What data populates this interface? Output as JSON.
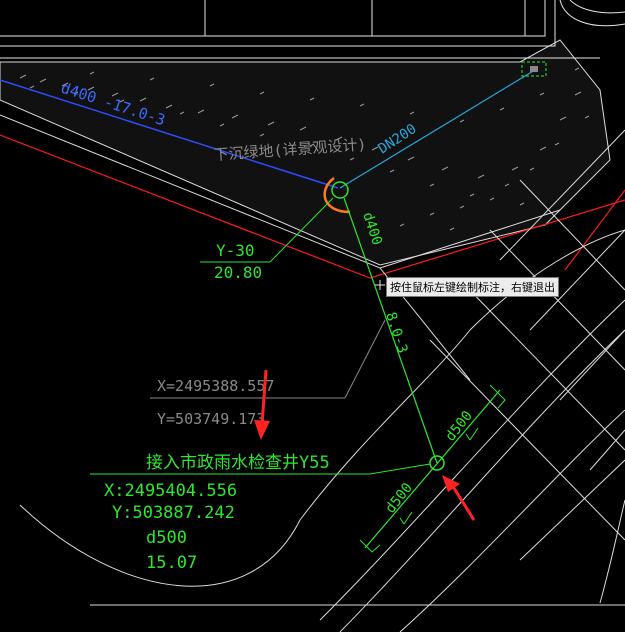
{
  "drawing": {
    "pipe_upstream_label": "d400 -17.0-3",
    "pipe_dn_label": "DN200",
    "area_label": "下沉绿地(详景观设计)",
    "manhole_id": "Y-30",
    "manhole_elev": "20.80",
    "pipe_down_label": "d400",
    "pipe_down_length": "8.0-3",
    "coord_x_grey": "X=2495388.557",
    "coord_y_grey": "Y=503749.173",
    "connect_label": "接入市政雨水检查井Y55",
    "connect_x": "X:2495404.556",
    "connect_y": "Y:503887.242",
    "connect_pipe": "d500",
    "connect_elev": "15.07",
    "main_pipe_left": "d500",
    "main_pipe_right": "d500"
  },
  "tooltip": {
    "text": "按住鼠标左键绘制标注，右键退出"
  },
  "colors": {
    "green": "#2ee62e",
    "white": "#e6e6e6",
    "red": "#ff1a1a",
    "blue": "#2f4cff",
    "cyan": "#2aa7d8",
    "orange": "#ff7a1a",
    "grey": "#8a8a8a"
  }
}
